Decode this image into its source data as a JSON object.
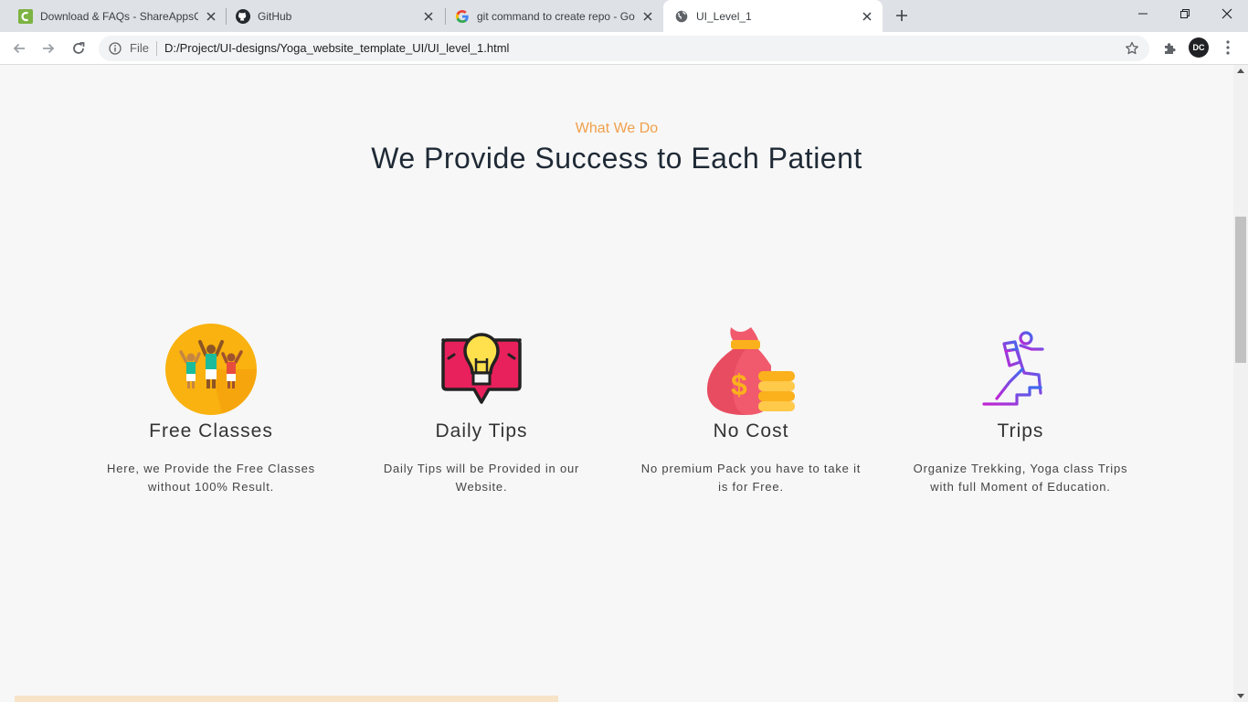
{
  "browser": {
    "tabs": [
      {
        "title": "Download & FAQs - ShareAppsC",
        "favicon": "shareapps-icon",
        "active": false
      },
      {
        "title": "GitHub",
        "favicon": "github-icon",
        "active": false
      },
      {
        "title": "git command to create repo - Go",
        "favicon": "google-icon",
        "active": false
      },
      {
        "title": "UI_Level_1",
        "favicon": "globe-icon",
        "active": true
      }
    ],
    "address": {
      "scheme_label": "File",
      "url": "D:/Project/UI-designs/Yoga_website_template_UI/UI_level_1.html"
    },
    "profile_initials": "DC"
  },
  "page": {
    "eyebrow": "What We Do",
    "headline": "We Provide Success to Each Patient",
    "services": [
      {
        "title": "Free Classes",
        "text": "Here, we Provide the Free Classes without 100% Result.",
        "icon": "group-celebration-icon"
      },
      {
        "title": "Daily Tips",
        "text": "Daily Tips will be Provided in our Website.",
        "icon": "lightbulb-icon"
      },
      {
        "title": "No Cost",
        "text": "No premium Pack you have to take it is for Free.",
        "icon": "money-bag-icon"
      },
      {
        "title": "Trips",
        "text": "Organize Trekking, Yoga class Trips with full Moment of Education.",
        "icon": "hiker-icon"
      }
    ]
  },
  "colors": {
    "accent": "#f0a04b",
    "headline": "#1f2a36",
    "background": "#f7f7f7"
  }
}
